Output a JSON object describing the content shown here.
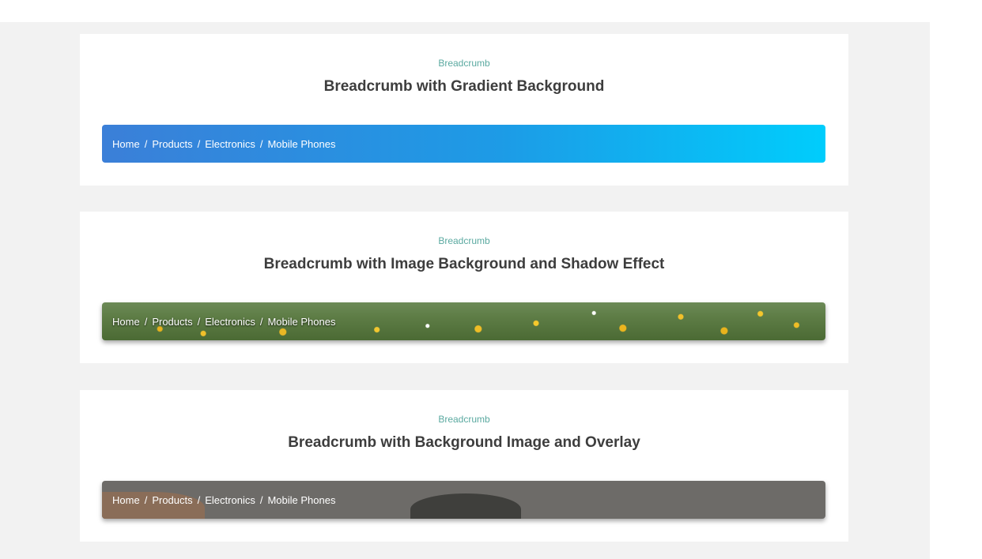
{
  "cards": [
    {
      "eyebrow": "Breadcrumb",
      "title": "Breadcrumb with Gradient Background",
      "crumbs": [
        "Home",
        "Products",
        "Electronics",
        "Mobile Phones"
      ]
    },
    {
      "eyebrow": "Breadcrumb",
      "title": "Breadcrumb with Image Background and Shadow Effect",
      "crumbs": [
        "Home",
        "Products",
        "Electronics",
        "Mobile Phones"
      ]
    },
    {
      "eyebrow": "Breadcrumb",
      "title": "Breadcrumb with Background Image and Overlay",
      "crumbs": [
        "Home",
        "Products",
        "Electronics",
        "Mobile Phones"
      ]
    }
  ],
  "separator": "/",
  "colors": {
    "eyebrow": "#5aa9a0",
    "title": "#3d3d3d",
    "gradient_start": "#3b7fd8",
    "gradient_end": "#00cdfc",
    "overlay": "#6d6b68",
    "page_background": "#f2f2f2"
  }
}
